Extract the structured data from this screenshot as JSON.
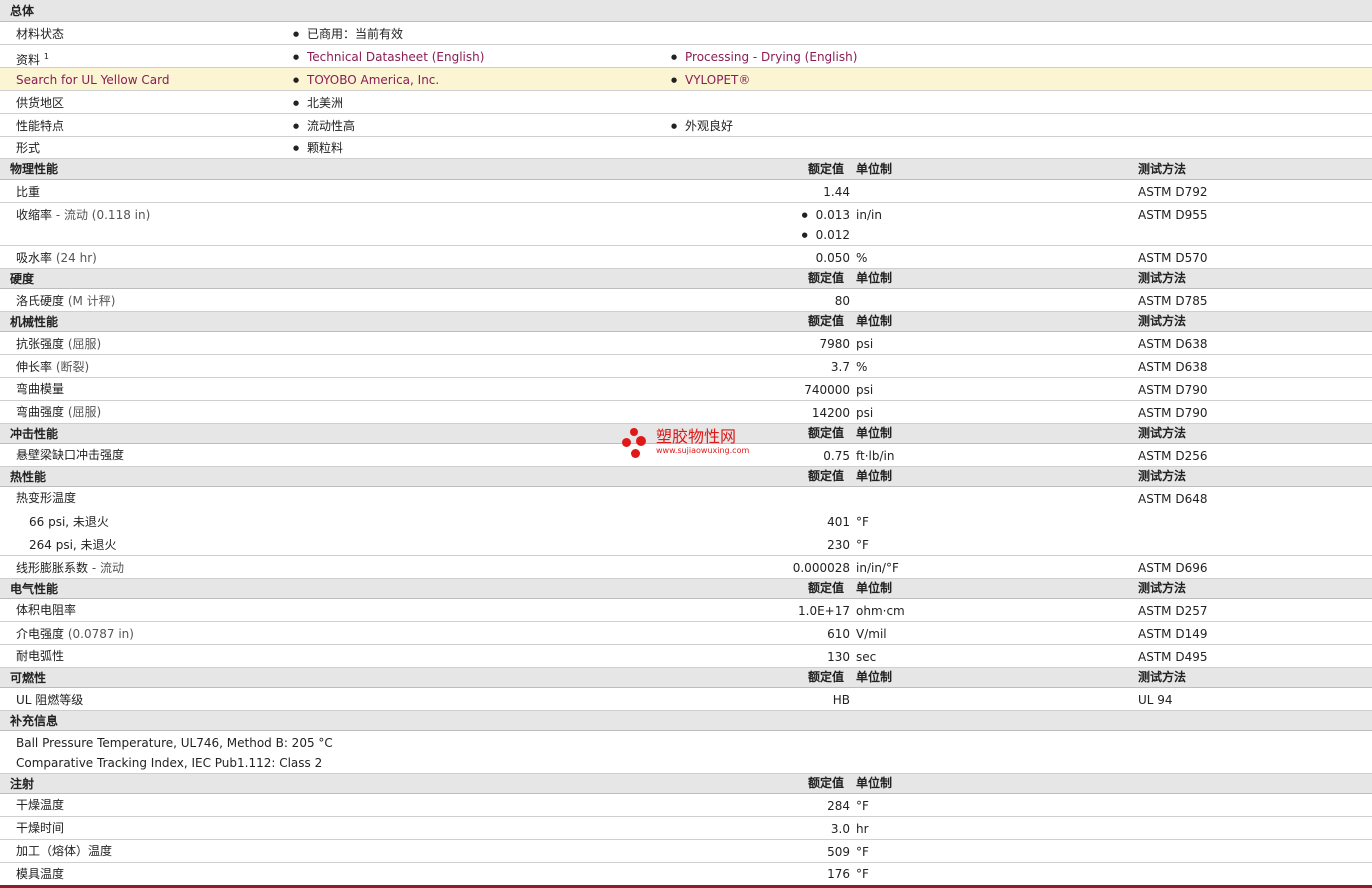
{
  "general": {
    "title": "总体",
    "status_label": "材料状态",
    "status_value": "已商用：当前有效",
    "docs_label": "资料",
    "docs_sup": "1",
    "doc1": "Technical Datasheet (English)",
    "doc2": "Processing - Drying (English)",
    "ul_label": "Search for UL Yellow Card",
    "ul_company": "TOYOBO America, Inc.",
    "ul_product": "VYLOPET®",
    "region_label": "供货地区",
    "region_value": "北美洲",
    "features_label": "性能特点",
    "feature1": "流动性高",
    "feature2": "外观良好",
    "form_label": "形式",
    "form_value": "颗粒料"
  },
  "headers": {
    "value": "额定值",
    "unit": "单位制",
    "test": "测试方法"
  },
  "physical": {
    "title": "物理性能",
    "sg_label": "比重",
    "sg_value": "1.44",
    "sg_test": "ASTM D792",
    "shrink_label": "收缩率",
    "shrink_note": "- 流动  (0.118 in)",
    "shrink_v1": "0.013",
    "shrink_u1": "in/in",
    "shrink_v2": "0.012",
    "shrink_test": "ASTM D955",
    "water_label": "吸水率",
    "water_note": "(24 hr)",
    "water_value": "0.050",
    "water_unit": "%",
    "water_test": "ASTM D570"
  },
  "hardness": {
    "title": "硬度",
    "rock_label": "洛氏硬度",
    "rock_note": "(M 计秤)",
    "rock_value": "80",
    "rock_test": "ASTM D785"
  },
  "mechanical": {
    "title": "机械性能",
    "ts_label": "抗张强度",
    "ts_note": "(屈服)",
    "ts_value": "7980",
    "ts_unit": "psi",
    "ts_test": "ASTM D638",
    "el_label": "伸长率",
    "el_note": "(断裂)",
    "el_value": "3.7",
    "el_unit": "%",
    "el_test": "ASTM D638",
    "fm_label": "弯曲模量",
    "fm_value": "740000",
    "fm_unit": "psi",
    "fm_test": "ASTM D790",
    "fs_label": "弯曲强度",
    "fs_note": "(屈服)",
    "fs_value": "14200",
    "fs_unit": "psi",
    "fs_test": "ASTM D790"
  },
  "impact": {
    "title": "冲击性能",
    "izod_label": "悬壁梁缺口冲击强度",
    "izod_value": "0.75",
    "izod_unit": "ft·lb/in",
    "izod_test": "ASTM D256"
  },
  "thermal": {
    "title": "热性能",
    "hdt_label": "热变形温度",
    "hdt_test": "ASTM D648",
    "hdt1_label": "66 psi, 未退火",
    "hdt1_value": "401",
    "hdt1_unit": "°F",
    "hdt2_label": "264 psi, 未退火",
    "hdt2_value": "230",
    "hdt2_unit": "°F",
    "clte_label": "线形膨胀系数",
    "clte_note": "- 流动",
    "clte_value": "0.000028",
    "clte_unit": "in/in/°F",
    "clte_test": "ASTM D696"
  },
  "electrical": {
    "title": "电气性能",
    "vr_label": "体积电阻率",
    "vr_value": "1.0E+17",
    "vr_unit": "ohm·cm",
    "vr_test": "ASTM D257",
    "ds_label": "介电强度",
    "ds_note": "(0.0787 in)",
    "ds_value": "610",
    "ds_unit": "V/mil",
    "ds_test": "ASTM D149",
    "arc_label": "耐电弧性",
    "arc_value": "130",
    "arc_unit": "sec",
    "arc_test": "ASTM D495"
  },
  "flammability": {
    "title": "可燃性",
    "ul_label": "UL 阻燃等级",
    "ul_value": "HB",
    "ul_test": "UL 94"
  },
  "supplemental": {
    "title": "补充信息",
    "line1": "Ball Pressure Temperature, UL746, Method B: 205 °C",
    "line2": "Comparative Tracking Index, IEC Pub1.112: Class 2"
  },
  "injection": {
    "title": "注射",
    "dt_label": "干燥温度",
    "dt_value": "284",
    "dt_unit": "°F",
    "dtime_label": "干燥时间",
    "dtime_value": "3.0",
    "dtime_unit": "hr",
    "melt_label": "加工（熔体）温度",
    "melt_value": "509",
    "melt_unit": "°F",
    "mold_label": "模具温度",
    "mold_value": "176",
    "mold_unit": "°F"
  },
  "watermark": {
    "title": "塑胶物性网",
    "url": "www.sujiaowuxing.com"
  }
}
